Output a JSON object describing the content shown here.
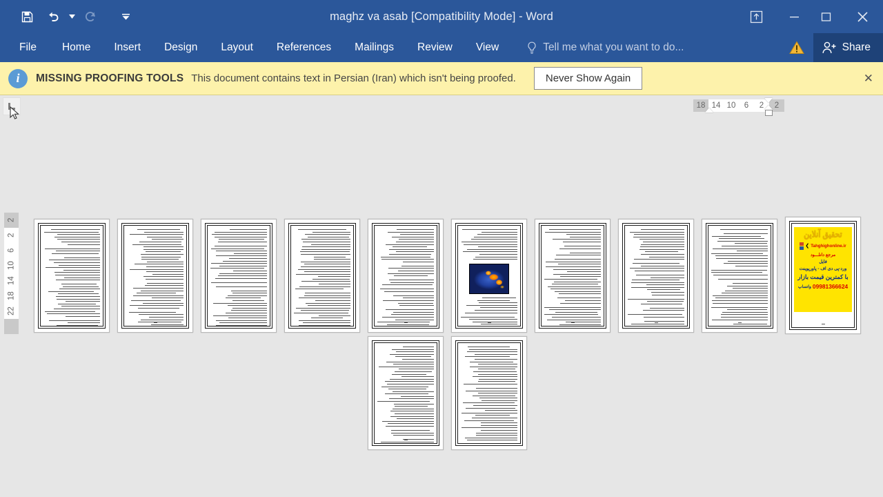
{
  "window": {
    "title": "maghz va asab [Compatibility Mode] - Word",
    "quick_access": [
      {
        "name": "save-button",
        "icon": "save-icon"
      },
      {
        "name": "undo-button",
        "icon": "undo-icon"
      },
      {
        "name": "redo-button",
        "icon": "redo-icon"
      },
      {
        "name": "customize-quick-access-toolbar",
        "icon": "chevron-down-icon"
      }
    ],
    "controls": [
      {
        "name": "ribbon-display-options-button",
        "icon": "ribbon-options-icon"
      },
      {
        "name": "minimize-button",
        "icon": "minimize-icon"
      },
      {
        "name": "maximize-button",
        "icon": "maximize-icon"
      },
      {
        "name": "close-button",
        "icon": "close-icon"
      }
    ]
  },
  "ribbon": {
    "tabs": [
      {
        "label": "File"
      },
      {
        "label": "Home"
      },
      {
        "label": "Insert"
      },
      {
        "label": "Design"
      },
      {
        "label": "Layout"
      },
      {
        "label": "References"
      },
      {
        "label": "Mailings"
      },
      {
        "label": "Review"
      },
      {
        "label": "View"
      }
    ],
    "tell_me_placeholder": "Tell me what you want to do...",
    "share_label": "Share",
    "accent_color": "#2b579a"
  },
  "message_bar": {
    "title": "MISSING PROOFING TOOLS",
    "text": "This document contains text in Persian (Iran) which isn't being proofed.",
    "button_label": "Never Show Again",
    "close_label": "✕",
    "background": "#fdf2ab"
  },
  "rulers": {
    "horizontal_ticks": [
      "18",
      "14",
      "10",
      "6",
      "2",
      "2"
    ],
    "vertical_ticks": [
      "2",
      "2",
      "6",
      "10",
      "14",
      "18",
      "22"
    ]
  },
  "document": {
    "page_count": 12,
    "pages": [
      {
        "index": 1,
        "kind": "text"
      },
      {
        "index": 2,
        "kind": "text"
      },
      {
        "index": 3,
        "kind": "text"
      },
      {
        "index": 4,
        "kind": "text"
      },
      {
        "index": 5,
        "kind": "text"
      },
      {
        "index": 6,
        "kind": "image",
        "image_name": "brain-fmri-scan"
      },
      {
        "index": 7,
        "kind": "text"
      },
      {
        "index": 8,
        "kind": "text"
      },
      {
        "index": 9,
        "kind": "text"
      },
      {
        "index": 10,
        "kind": "advertisement"
      },
      {
        "index": 11,
        "kind": "text"
      },
      {
        "index": 12,
        "kind": "text"
      }
    ],
    "advertisement": {
      "heading": "تحقیق آنلاین",
      "url": "Tahghighonline.ir",
      "line1": "مرجع دانلـــود",
      "line2": "فایل",
      "line3": "ورد-پی دی اف - پاورپوینت",
      "line4": "با کمترین قیمت بازار",
      "phone": "09981366624",
      "whatsapp": "واتساپ",
      "background": "#ffe400"
    }
  }
}
